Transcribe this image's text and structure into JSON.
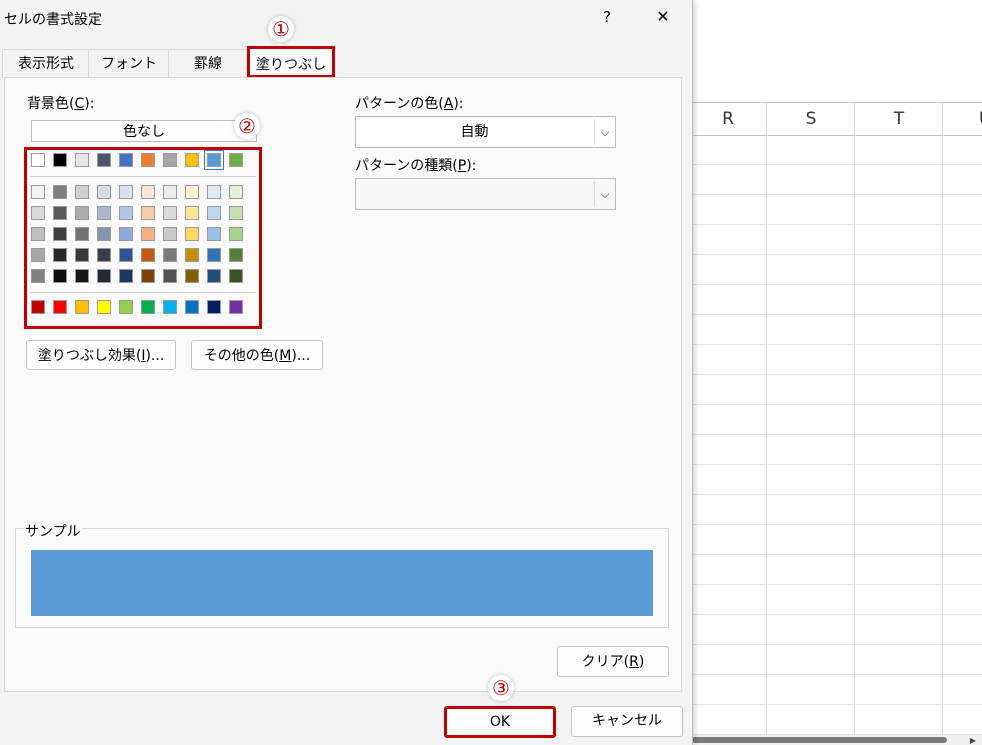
{
  "dialog": {
    "title": "セルの書式設定",
    "help": "?",
    "close": "✕",
    "tabs": [
      {
        "label": "表示形式"
      },
      {
        "label": "フォント"
      },
      {
        "label": "罫線"
      },
      {
        "label": "塗りつぶし",
        "active": true
      }
    ]
  },
  "fill": {
    "background_label_text": "背景色(",
    "background_label_key": "C",
    "background_label_end": "):",
    "no_color_label": "色なし",
    "theme_row_colors": [
      "#FFFFFF",
      "#000000",
      "#E7E6E6",
      "#44546A",
      "#4472C4",
      "#ED7D31",
      "#A5A5A5",
      "#FFC000",
      "#5B9BD5",
      "#70AD47"
    ],
    "tint_rows": [
      [
        "#F2F2F2",
        "#7F7F7F",
        "#D0CECE",
        "#D6DCE4",
        "#D9E1F2",
        "#FCE4D6",
        "#EDEDED",
        "#FFF2CC",
        "#DDEBF7",
        "#E2EFDA"
      ],
      [
        "#D9D9D9",
        "#595959",
        "#AEAAAA",
        "#ACB9CA",
        "#B4C6E7",
        "#F8CBAD",
        "#DBDBDB",
        "#FFE699",
        "#BDD7EE",
        "#C6E0B4"
      ],
      [
        "#BFBFBF",
        "#404040",
        "#757171",
        "#8497B0",
        "#8EA9DB",
        "#F4B084",
        "#C9C9C9",
        "#FFD966",
        "#9BC2E6",
        "#A9D08E"
      ],
      [
        "#A6A6A6",
        "#262626",
        "#3A3838",
        "#333F4F",
        "#305496",
        "#C65911",
        "#7B7B7B",
        "#BF8F00",
        "#2F75B5",
        "#548235"
      ],
      [
        "#808080",
        "#0D0D0D",
        "#161616",
        "#222B35",
        "#203764",
        "#833C0C",
        "#525252",
        "#806000",
        "#1F4E78",
        "#375623"
      ]
    ],
    "standard_colors": [
      "#C00000",
      "#FF0000",
      "#FFC000",
      "#FFFF00",
      "#92D050",
      "#00B050",
      "#00B0F0",
      "#0070C0",
      "#002060",
      "#7030A0"
    ],
    "selected_color": "#5B9BD5",
    "fill_effects_label_text": "塗りつぶし効果(",
    "fill_effects_label_key": "I",
    "fill_effects_label_end": ")...",
    "more_colors_label_text": "その他の色(",
    "more_colors_label_key": "M",
    "more_colors_label_end": ")...",
    "pattern_color_label_text": "パターンの色(",
    "pattern_color_label_key": "A",
    "pattern_color_label_end": "):",
    "pattern_color_value": "自動",
    "pattern_style_label_text": "パターンの種類(",
    "pattern_style_label_key": "P",
    "pattern_style_label_end": "):",
    "pattern_style_value": "",
    "sample_label": "サンプル",
    "sample_color": "#5B9BD5",
    "clear_label_text": "クリア(",
    "clear_label_key": "R",
    "clear_label_end": ")"
  },
  "footer": {
    "ok_label": "OK",
    "cancel_label": "キャンセル"
  },
  "annotations": {
    "step1": "①",
    "step2": "②",
    "step3": "③",
    "highlight_color": "#C00000"
  },
  "sheet": {
    "columns": [
      "R",
      "S",
      "T",
      "U"
    ]
  }
}
